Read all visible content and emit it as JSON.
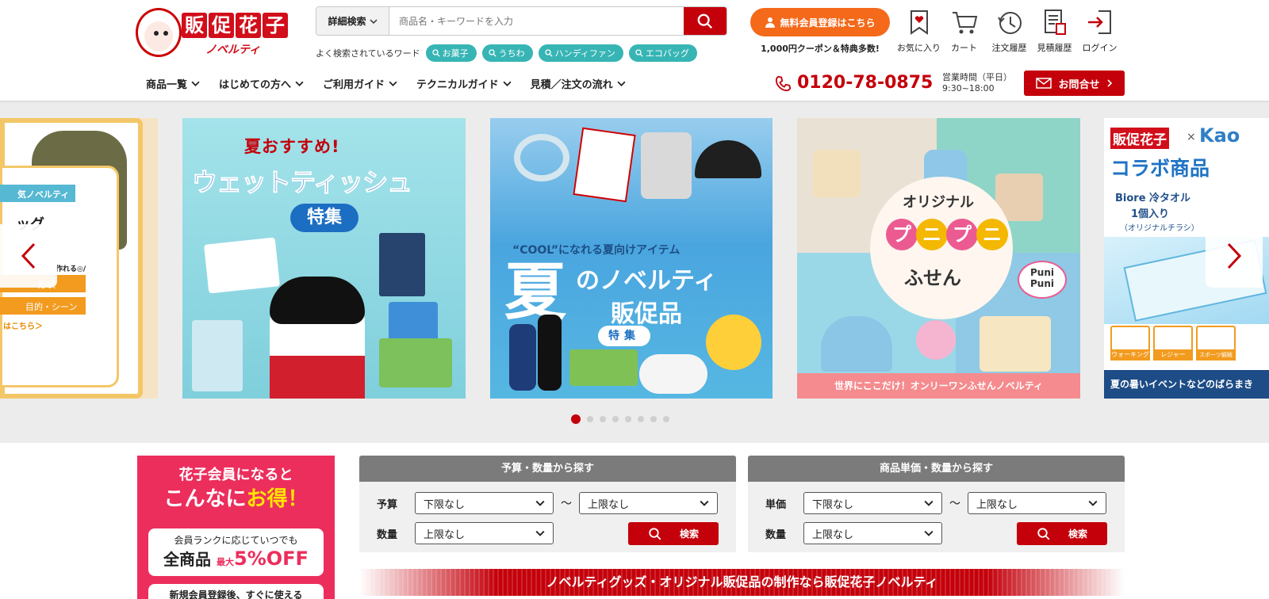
{
  "header": {
    "logo_brand": "販促花子",
    "logo_sub": "ノベルティ",
    "search": {
      "advanced_label": "詳細検索",
      "placeholder": "商品名・キーワードを入力"
    },
    "popular_label": "よく検索されているワード",
    "popular_tags": [
      "お菓子",
      "うちわ",
      "ハンディファン",
      "エコバッグ"
    ],
    "register_label": "無料会員登録はこちら",
    "coupon_text": "1,000円クーポン＆特典多数!",
    "tools": [
      {
        "label": "お気に入り",
        "icon": "heart-bookmark-icon"
      },
      {
        "label": "カート",
        "icon": "cart-icon"
      },
      {
        "label": "注文履歴",
        "icon": "history-clock-icon"
      },
      {
        "label": "見積履歴",
        "icon": "estimate-icon"
      },
      {
        "label": "ログイン",
        "icon": "login-icon"
      }
    ]
  },
  "nav": {
    "items": [
      "商品一覧",
      "はじめての方へ",
      "ご利用ガイド",
      "テクニカルガイド",
      "見積／注文の流れ"
    ],
    "phone": "0120-78-0875",
    "hours_label": "営業時間（平日）",
    "hours": "9:30~18:00",
    "inquiry_label": "お問合せ"
  },
  "carousel": {
    "slides": [
      {
        "lines": [
          "気ノベルティ",
          "ッグ",
          "作れる◎/",
          "形状",
          "目的・シーン",
          "はこちら＞"
        ]
      },
      {
        "lines": [
          "夏おすすめ!",
          "ウェットティッシュ",
          "特集"
        ]
      },
      {
        "lines": [
          "“COOL”になれる夏向けアイテム",
          "夏",
          "のノベルティ",
          "販促品",
          "特集"
        ]
      },
      {
        "lines": [
          "オリジナル",
          "プ",
          "ニ",
          "プ",
          "ニ",
          "ふせん",
          "Puni",
          "Puni",
          "世界にここだけ！オンリーワンふせんノベルティ"
        ]
      },
      {
        "lines": [
          "販促花子",
          "×",
          "Kao",
          "コラボ商品",
          "Biore 冷タオル",
          "1個入り",
          "（オリジナルチラシ）",
          "ウォーキング",
          "レジャー",
          "スポーツ観戦",
          "夏の暑いイベントなどのばらまき"
        ]
      }
    ],
    "dot_count": 8,
    "active_dot": 0
  },
  "member": {
    "line1": "花子会員になると",
    "line2a": "こんなに",
    "line2b": "お得！",
    "box_line1": "会員ランクに応じていつでも",
    "box_line2a": "全商品",
    "box_line2b": "最大",
    "box_line2c": "5%OFF",
    "line3": "新規会員登録後、すぐに使える"
  },
  "budget_search": {
    "title": "予算・数量から探す",
    "row1_label": "予算",
    "min_value": "下限なし",
    "max_value": "上限なし",
    "tilde": "～",
    "row2_label": "数量",
    "qty_value": "上限なし",
    "button": "検索"
  },
  "unit_search": {
    "title": "商品単価・数量から探す",
    "row1_label": "単価",
    "min_value": "下限なし",
    "max_value": "上限なし",
    "tilde": "～",
    "row2_label": "数量",
    "qty_value": "上限なし",
    "button": "検索"
  },
  "banner_text": "ノベルティグッズ・オリジナル販促品の制作なら販促花子ノベルティ",
  "colors": {
    "primary": "#c4000b",
    "orange": "#f4691a",
    "teal": "#37b5b5",
    "pink": "#ec2e5d"
  }
}
